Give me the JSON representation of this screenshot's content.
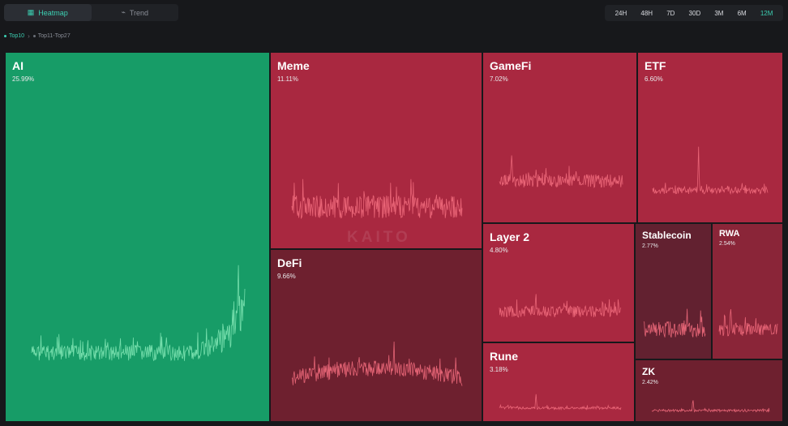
{
  "view_tabs": [
    {
      "label": "Heatmap",
      "icon": "heatmap-icon",
      "active": true
    },
    {
      "label": "Trend",
      "icon": "trend-icon",
      "active": false
    }
  ],
  "time_ranges": [
    "24H",
    "48H",
    "7D",
    "30D",
    "3M",
    "6M",
    "12M"
  ],
  "active_range": "12M",
  "breadcrumb": {
    "current": "Top10",
    "separator_icon": "chevron-right-icon",
    "other": "Top11-Top27"
  },
  "watermark": "KAITO",
  "colors": {
    "positive": "#179c67",
    "red_bright": "#a92840",
    "red_mid": "#962e43",
    "red_dark": "#6e202f",
    "red_darker": "#622130",
    "accent": "#3ccfb2",
    "line_up": "#7fe6b4",
    "line_down": "#f06a7c"
  },
  "tiles": [
    {
      "id": "ai",
      "name": "AI",
      "percent": "25.99%"
    },
    {
      "id": "meme",
      "name": "Meme",
      "percent": "11.11%"
    },
    {
      "id": "gamefi",
      "name": "GameFi",
      "percent": "7.02%"
    },
    {
      "id": "etf",
      "name": "ETF",
      "percent": "6.60%"
    },
    {
      "id": "defi",
      "name": "DeFi",
      "percent": "9.66%"
    },
    {
      "id": "layer2",
      "name": "Layer 2",
      "percent": "4.80%"
    },
    {
      "id": "stablecoin",
      "name": "Stablecoin",
      "percent": "2.77%"
    },
    {
      "id": "rwa",
      "name": "RWA",
      "percent": "2.54%"
    },
    {
      "id": "rune",
      "name": "Rune",
      "percent": "3.18%"
    },
    {
      "id": "zk",
      "name": "ZK",
      "percent": "2.42%"
    }
  ]
}
